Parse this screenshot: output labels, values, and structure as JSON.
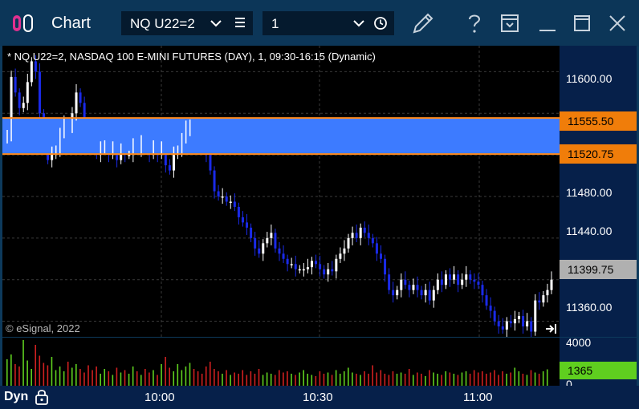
{
  "titlebar": {
    "title": "Chart",
    "symbol": "NQ U22=2",
    "interval": "1"
  },
  "chart": {
    "header": "* NQ U22=2, NASDAQ 100 E-MINI FUTURES (DAY), 1, 09:30-16:15 (Dynamic)",
    "copyright": "© eSignal, 2022",
    "price_labels": [
      "11600.00",
      "11480.00",
      "11440.00",
      "11360.00"
    ],
    "badges": {
      "upper_line": "11555.50",
      "lower_line": "11520.75",
      "last_price": "11399.75"
    },
    "colors": {
      "up": "#ffffff",
      "down": "#1a2ae8",
      "zone": "#3d7bff",
      "line": "#ff8a1c",
      "last_badge": "#b0b0b0"
    }
  },
  "volume": {
    "axis_top": "4000",
    "axis_bottom": "0",
    "current": "1365"
  },
  "time_axis": {
    "mode": "Dyn",
    "labels": [
      "10:00",
      "10:30",
      "11:00"
    ]
  },
  "chart_data": {
    "type": "candlestick",
    "ylim": [
      11345,
      11625
    ],
    "y_ticks": [
      11360,
      11400,
      11440,
      11480,
      11520,
      11560,
      11600
    ],
    "x_ticks": [
      "10:00",
      "10:30",
      "11:00"
    ],
    "horizontal_lines": [
      11555.5,
      11520.75
    ],
    "last_price": 11399.75,
    "closes": [
      11540,
      11595,
      11580,
      11565,
      11570,
      11590,
      11610,
      11600,
      11560,
      11530,
      11515,
      11520,
      11525,
      11540,
      11550,
      11545,
      11560,
      11580,
      11570,
      11540,
      11535,
      11530,
      11520,
      11525,
      11530,
      11520,
      11525,
      11515,
      11525,
      11520,
      11520,
      11530,
      11525,
      11535,
      11525,
      11520,
      11530,
      11520,
      11525,
      11510,
      11505,
      11520,
      11525,
      11535,
      11545,
      11550,
      11540,
      11535,
      11530,
      11520,
      11505,
      11485,
      11480,
      11480,
      11475,
      11475,
      11470,
      11460,
      11455,
      11450,
      11440,
      11430,
      11425,
      11435,
      11440,
      11445,
      11430,
      11425,
      11420,
      11415,
      11415,
      11410,
      11410,
      11410,
      11412,
      11418,
      11415,
      11410,
      11405,
      11410,
      11408,
      11420,
      11425,
      11430,
      11440,
      11445,
      11440,
      11450,
      11445,
      11440,
      11435,
      11425,
      11420,
      11405,
      11390,
      11385,
      11390,
      11400,
      11395,
      11390,
      11395,
      11390,
      11385,
      11390,
      11380,
      11390,
      11400,
      11395,
      11405,
      11400,
      11405,
      11395,
      11400,
      11405,
      11400,
      11398,
      11395,
      11385,
      11375,
      11370,
      11360,
      11355,
      11352,
      11360,
      11358,
      11362,
      11365,
      11355,
      11360,
      11350,
      11380,
      11378,
      11385,
      11390,
      11400
    ],
    "volumes": [
      2200,
      2600,
      1800,
      1600,
      3800,
      2100,
      1400,
      3400,
      2500,
      1900,
      1700,
      2400,
      1300,
      1600,
      1200,
      2000,
      1500,
      1800,
      1400,
      1100,
      1700,
      1300,
      1600,
      1000,
      1400,
      1200,
      900,
      1500,
      1100,
      1300,
      1000,
      1600,
      1200,
      900,
      1400,
      1100,
      1300,
      900,
      1800,
      2400,
      1500,
      1200,
      1800,
      1300,
      1600,
      1900,
      1400,
      1200,
      1000,
      1600,
      2000,
      1400,
      1200,
      1000,
      1300,
      900,
      1100,
      1000,
      1300,
      900,
      1200,
      1000,
      1400,
      900,
      1100,
      1000,
      900,
      1300,
      1100,
      1200,
      1000,
      900,
      1100,
      1300,
      1000,
      900,
      800,
      1200,
      1000,
      1100,
      900,
      1300,
      1000,
      1200,
      1500,
      1100,
      1000,
      900,
      1200,
      1000,
      1700,
      1100,
      1300,
      1000,
      900,
      1200,
      1000,
      1100,
      1000,
      1400,
      900,
      1100,
      1000,
      800,
      1300,
      1100,
      1000,
      900,
      1200,
      1100,
      1000,
      900,
      1100,
      1200,
      1000,
      1300,
      1100,
      1200,
      1000,
      1100,
      1300,
      900,
      1200,
      1000,
      1100,
      1500,
      1200,
      1000,
      900,
      1300,
      1100,
      1000,
      1200,
      1365
    ]
  }
}
